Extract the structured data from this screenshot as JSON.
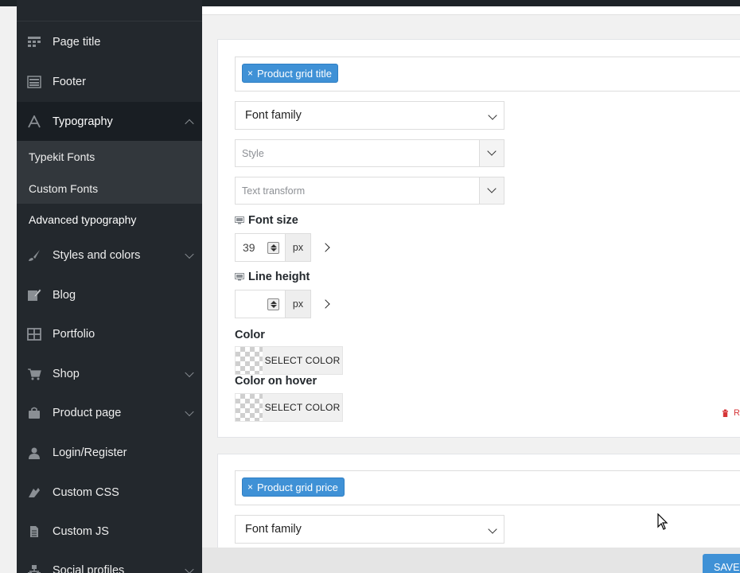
{
  "sidebar": {
    "items": [
      {
        "label": "Page title",
        "icon": "page-title-icon"
      },
      {
        "label": "Footer",
        "icon": "footer-icon"
      },
      {
        "label": "Typography",
        "icon": "typography-icon"
      },
      {
        "label": "Styles and colors",
        "icon": "brush-icon"
      },
      {
        "label": "Blog",
        "icon": "edit-icon"
      },
      {
        "label": "Portfolio",
        "icon": "grid-icon"
      },
      {
        "label": "Shop",
        "icon": "cart-icon"
      },
      {
        "label": "Product page",
        "icon": "bag-icon"
      },
      {
        "label": "Login/Register",
        "icon": "user-icon"
      },
      {
        "label": "Custom CSS",
        "icon": "css-icon"
      },
      {
        "label": "Custom JS",
        "icon": "document-icon"
      },
      {
        "label": "Social profiles",
        "icon": "network-icon"
      }
    ],
    "submenu": [
      "Typekit Fonts",
      "Custom Fonts",
      "Advanced typography"
    ]
  },
  "section1": {
    "tag": "Product grid title",
    "tag_remove": "×",
    "font_family": "Font family",
    "style_placeholder": "Style",
    "text_transform_placeholder": "Text transform",
    "font_size_label": "Font size",
    "font_size_value": "39",
    "font_size_unit": "px",
    "line_height_label": "Line height",
    "line_height_value": "",
    "line_height_unit": "px",
    "color_label": "Color",
    "color_button": "SELECT COLOR",
    "color_hover_label": "Color on hover",
    "color_hover_button": "SELECT COLOR",
    "reset_label": "R"
  },
  "section2": {
    "tag": "Product grid price",
    "tag_remove": "×",
    "font_family": "Font family"
  },
  "footer": {
    "save_label": "SAVE"
  },
  "colors": {
    "sidebar_bg": "#23282d",
    "submenu_bg": "#32373c",
    "accent": "#3f91d6",
    "reset": "#d63638"
  }
}
